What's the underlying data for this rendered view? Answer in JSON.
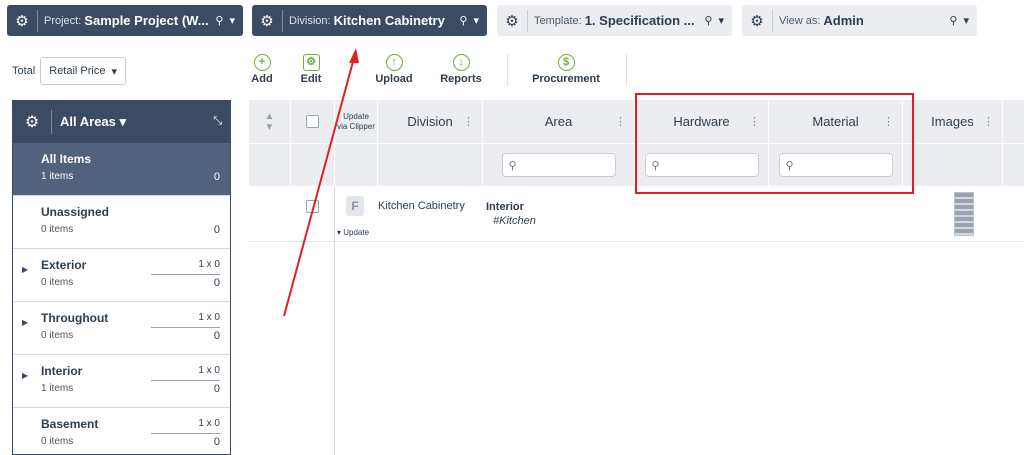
{
  "topbars": {
    "project": {
      "label": "Project:",
      "value": "Sample Project (W..."
    },
    "division": {
      "label": "Division:",
      "value": "Kitchen Cabinetry"
    },
    "template": {
      "label": "Template:",
      "value": "1. Specification ..."
    },
    "view": {
      "label": "View as:",
      "value": "Admin"
    }
  },
  "total": {
    "label": "Total",
    "value": "Retail Price"
  },
  "toolbar": {
    "add": "Add",
    "edit": "Edit",
    "upload": "Upload",
    "reports": "Reports",
    "procurement": "Procurement"
  },
  "sidebar": {
    "title": "All Areas",
    "items": [
      {
        "name": "All Items",
        "count": "1 items",
        "total": "0",
        "dim": ""
      },
      {
        "name": "Unassigned",
        "count": "0 items",
        "total": "0",
        "dim": ""
      },
      {
        "name": "Exterior",
        "count": "0 items",
        "total": "0",
        "dim": "1 x 0"
      },
      {
        "name": "Throughout",
        "count": "0 items",
        "total": "0",
        "dim": "1 x 0"
      },
      {
        "name": "Interior",
        "count": "1 items",
        "total": "0",
        "dim": "1 x 0"
      },
      {
        "name": "Basement",
        "count": "0 items",
        "total": "0",
        "dim": "1 x 0"
      }
    ]
  },
  "grid": {
    "headers": {
      "update_via": "Update via Clipper",
      "division": "Division",
      "area": "Area",
      "hardware": "Hardware",
      "material": "Material",
      "images": "Images"
    },
    "row": {
      "badge": "F",
      "update": "Update",
      "division": "Kitchen Cabinetry",
      "area": "Interior",
      "area_tag": "#Kitchen"
    }
  },
  "colors": {
    "navy": "#3c4b64",
    "accent_green": "#6fae3c",
    "highlight_red": "#e02020"
  }
}
